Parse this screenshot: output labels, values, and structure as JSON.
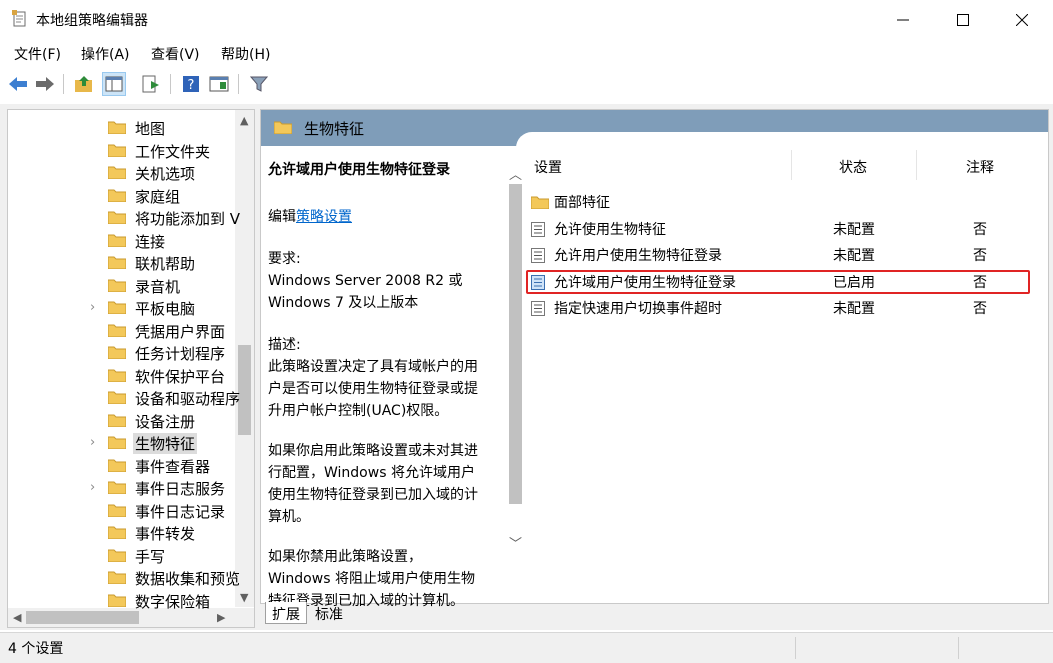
{
  "window": {
    "title": "本地组策略编辑器"
  },
  "menu": [
    "文件(F)",
    "操作(A)",
    "查看(V)",
    "帮助(H)"
  ],
  "toolbar": [
    "back-icon",
    "forward-icon",
    "up-folder-icon",
    "show-hide-tree-icon",
    "export-list-icon",
    "help-icon",
    "properties-icon",
    "filter-icon"
  ],
  "tree": {
    "items": [
      {
        "label": "地图",
        "expandable": false
      },
      {
        "label": "工作文件夹",
        "expandable": false
      },
      {
        "label": "关机选项",
        "expandable": false
      },
      {
        "label": "家庭组",
        "expandable": false
      },
      {
        "label": "将功能添加到 V",
        "expandable": false
      },
      {
        "label": "连接",
        "expandable": false
      },
      {
        "label": "联机帮助",
        "expandable": false
      },
      {
        "label": "录音机",
        "expandable": false
      },
      {
        "label": "平板电脑",
        "expandable": true
      },
      {
        "label": "凭据用户界面",
        "expandable": false
      },
      {
        "label": "任务计划程序",
        "expandable": false
      },
      {
        "label": "软件保护平台",
        "expandable": false
      },
      {
        "label": "设备和驱动程序",
        "expandable": false
      },
      {
        "label": "设备注册",
        "expandable": false
      },
      {
        "label": "生物特征",
        "expandable": true,
        "selected": true
      },
      {
        "label": "事件查看器",
        "expandable": false
      },
      {
        "label": "事件日志服务",
        "expandable": true
      },
      {
        "label": "事件日志记录",
        "expandable": false
      },
      {
        "label": "事件转发",
        "expandable": false
      },
      {
        "label": "手写",
        "expandable": false
      },
      {
        "label": "数据收集和预览",
        "expandable": false
      },
      {
        "label": "数字保险箱",
        "expandable": false
      }
    ]
  },
  "right": {
    "header": "生物特征",
    "extended": {
      "title": "允许域用户使用生物特征登录",
      "edit_prefix": "编辑",
      "edit_link": "策略设置",
      "req_label": "要求:",
      "req_line1": "Windows Server 2008 R2 或",
      "req_line2": "Windows 7 及以上版本",
      "desc_label": "描述:",
      "desc_lines": [
        "此策略设置决定了具有域帐户的用",
        "户是否可以使用生物特征登录或提",
        "升用户帐户控制(UAC)权限。"
      ],
      "p2_lines": [
        "如果你启用此策略设置或未对其进",
        "行配置，Windows 将允许域用户",
        "使用生物特征登录到已加入域的计",
        "算机。"
      ],
      "p3_lines": [
        "如果你禁用此策略设置，",
        "Windows 将阻止域用户使用生物",
        "特征登录到已加入域的计算机。"
      ]
    },
    "columns": {
      "setting": "设置",
      "state": "状态",
      "comment": "注释"
    },
    "rows": [
      {
        "name": "面部特征",
        "state": "",
        "comment": "",
        "type": "folder"
      },
      {
        "name": "允许使用生物特征",
        "state": "未配置",
        "comment": "否",
        "type": "policy"
      },
      {
        "name": "允许用户使用生物特征登录",
        "state": "未配置",
        "comment": "否",
        "type": "policy"
      },
      {
        "name": "允许域用户使用生物特征登录",
        "state": "已启用",
        "comment": "否",
        "type": "policy",
        "selected": true
      },
      {
        "name": "指定快速用户切换事件超时",
        "state": "未配置",
        "comment": "否",
        "type": "policy"
      }
    ],
    "tabs": [
      "扩展",
      "标准"
    ]
  },
  "status": "4 个设置",
  "colors": {
    "header_bar": "#7f9db9",
    "highlight": "#e02424",
    "folder": "#f3c85a",
    "link": "#0066cc"
  }
}
